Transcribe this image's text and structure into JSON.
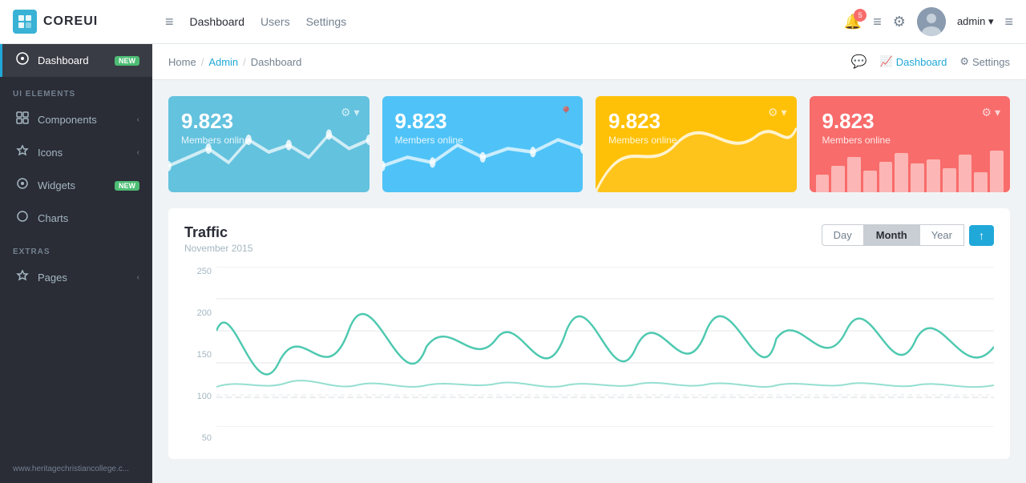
{
  "topnav": {
    "logo_text": "COREUI",
    "links": [
      "Dashboard",
      "Users",
      "Settings"
    ],
    "active_link": "Dashboard",
    "badge_count": "5",
    "admin_label": "admin ▾"
  },
  "sidebar": {
    "section1_label": "UI ELEMENTS",
    "items": [
      {
        "id": "dashboard",
        "label": "Dashboard",
        "icon": "⊙",
        "badge": "NEW",
        "active": true
      },
      {
        "id": "components",
        "label": "Components",
        "icon": "◫",
        "chevron": "‹"
      },
      {
        "id": "icons",
        "label": "Icons",
        "icon": "☆",
        "chevron": "‹"
      },
      {
        "id": "widgets",
        "label": "Widgets",
        "icon": "◈",
        "badge": "NEW"
      },
      {
        "id": "charts",
        "label": "Charts",
        "icon": "○"
      }
    ],
    "section2_label": "EXTRAS",
    "extras": [
      {
        "id": "pages",
        "label": "Pages",
        "icon": "☆",
        "chevron": "‹"
      }
    ],
    "footer_text": "www.heritagechristiancollege.c..."
  },
  "breadcrumb": {
    "items": [
      "Home",
      "Admin",
      "Dashboard"
    ],
    "active_index": 1,
    "actions": [
      {
        "label": "Dashboard",
        "icon": "📈"
      },
      {
        "label": "Settings",
        "icon": "⚙"
      }
    ]
  },
  "stat_cards": [
    {
      "value": "9.823",
      "label": "Members online",
      "type": "blue"
    },
    {
      "value": "9.823",
      "label": "Members online",
      "type": "light-blue"
    },
    {
      "value": "9.823",
      "label": "Members online",
      "type": "yellow"
    },
    {
      "value": "9.823",
      "label": "Members online",
      "type": "red"
    }
  ],
  "traffic": {
    "title": "Traffic",
    "subtitle": "November 2015",
    "time_buttons": [
      "Day",
      "Month",
      "Year"
    ],
    "active_time": "Month",
    "y_labels": [
      "250",
      "200",
      "150",
      "100",
      "50"
    ],
    "upload_icon": "↑"
  }
}
